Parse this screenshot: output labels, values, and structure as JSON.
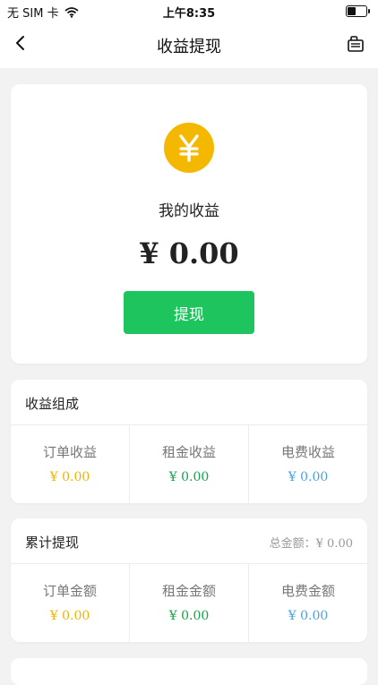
{
  "status_bar": {
    "carrier": "无 SIM 卡",
    "time": "上午8:35"
  },
  "nav": {
    "title": "收益提现",
    "back_icon": "chevron-left-icon",
    "record_icon": "record-icon"
  },
  "earnings": {
    "icon": "yen-icon",
    "label": "我的收益",
    "amount": "¥ 0.00",
    "withdraw_button": "提现",
    "button_color": "#1ec55e",
    "icon_color": "#f5b800"
  },
  "composition": {
    "title": "收益组成",
    "items": [
      {
        "label": "订单收益",
        "value": "¥ 0.00",
        "color": "#f2b200"
      },
      {
        "label": "租金收益",
        "value": "¥ 0.00",
        "color": "#16a34a"
      },
      {
        "label": "电费收益",
        "value": "¥ 0.00",
        "color": "#4aa3df"
      }
    ]
  },
  "withdrawal": {
    "title": "累计提现",
    "total_label": "总金额：",
    "total_value": "¥ 0.00",
    "items": [
      {
        "label": "订单金额",
        "value": "¥ 0.00",
        "color": "#f2b200"
      },
      {
        "label": "租金金额",
        "value": "¥ 0.00",
        "color": "#16a34a"
      },
      {
        "label": "电费金额",
        "value": "¥ 0.00",
        "color": "#4aa3df"
      }
    ]
  }
}
